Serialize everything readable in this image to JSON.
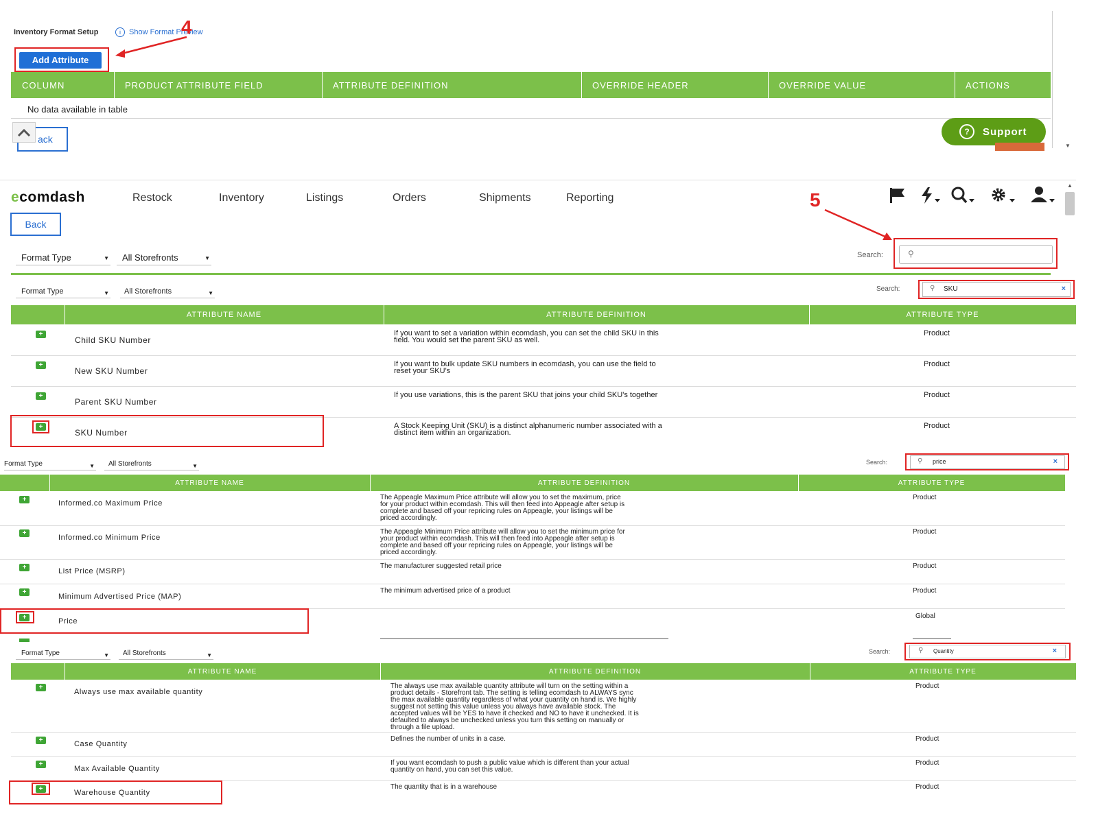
{
  "top": {
    "breadcrumb": "Inventory Format Setup",
    "info_icon": "info-circle-icon",
    "show_format_preview": "Show Format Preview",
    "add_attribute_label": "Add Attribute",
    "columns": [
      "COLUMN",
      "PRODUCT ATTRIBUTE FIELD",
      "ATTRIBUTE DEFINITION",
      "OVERRIDE HEADER",
      "OVERRIDE VALUE",
      "ACTIONS"
    ],
    "empty_text": "No data available in table",
    "back_label": "ack",
    "support_label": "Support",
    "annotation": "4"
  },
  "app": {
    "logo": "ecomdash",
    "nav": [
      "Restock",
      "Inventory",
      "Listings",
      "Orders",
      "Shipments",
      "Reporting"
    ],
    "back_label": "Back",
    "annotation": "5",
    "filter_format": "Format Type",
    "filter_store": "All Storefronts",
    "search_label": "Search:"
  },
  "panels": {
    "sku": {
      "search_value": "SKU",
      "headers": [
        "ATTRIBUTE NAME",
        "ATTRIBUTE DEFINITION",
        "ATTRIBUTE TYPE"
      ],
      "rows": [
        {
          "name": "Child SKU Number",
          "def1": "If you want to set a variation within ecomdash, you can set the child SKU in this",
          "def2": "field. You would set the parent SKU as well.",
          "type": "Product"
        },
        {
          "name": "New SKU Number",
          "def1": "If you want to bulk update SKU numbers in ecomdash, you can use the field to",
          "def2": "reset your SKU's",
          "type": "Product"
        },
        {
          "name": "Parent SKU Number",
          "def1": "If you use variations, this is the parent SKU that joins your child SKU's together",
          "def2": "",
          "type": "Product"
        },
        {
          "name": "SKU Number",
          "def1": "A Stock Keeping Unit (SKU) is a distinct alphanumeric number associated with a",
          "def2": "distinct item within an organization.",
          "type": "Product"
        }
      ]
    },
    "price": {
      "search_value": "price",
      "headers": [
        "ATTRIBUTE NAME",
        "ATTRIBUTE DEFINITION",
        "ATTRIBUTE TYPE"
      ],
      "rows": [
        {
          "name": "Informed.co Maximum Price",
          "def": [
            "The Appeagle Maximum Price attribute will allow you to set the maximum, price",
            "for your product within ecomdash. This will then feed into Appeagle after setup is",
            "complete and based off your repricing rules on Appeagle, your listings will be",
            "priced accordingly."
          ],
          "type": "Product"
        },
        {
          "name": "Informed.co Minimum Price",
          "def": [
            "The Appeagle Minimum Price attribute will allow you to set the minimum price for",
            "your product within ecomdash. This will then feed into Appeagle after setup is",
            "complete and based off your repricing rules on Appeagle, your listings will be",
            "priced accordingly."
          ],
          "type": "Product"
        },
        {
          "name": "List Price (MSRP)",
          "def": [
            "The manufacturer suggested retail price"
          ],
          "type": "Product"
        },
        {
          "name": "Minimum Advertised Price (MAP)",
          "def": [
            "The minimum advertised price of a product"
          ],
          "type": "Product"
        },
        {
          "name": "Price",
          "def": [],
          "type": "Global"
        }
      ]
    },
    "quantity": {
      "search_value": "Quantity",
      "headers": [
        "ATTRIBUTE NAME",
        "ATTRIBUTE DEFINITION",
        "ATTRIBUTE TYPE"
      ],
      "rows": [
        {
          "name": "Always use max available quantity",
          "def": [
            "The always use max available quantity attribute will turn on the setting within a",
            "product details - Storefront tab. The setting is telling ecomdash to ALWAYS sync",
            "the max available quantity regardless of what your quantity on hand is. We highly",
            "suggest not setting this value unless you always have available stock. The",
            "accepted values will be YES to have it checked and NO to have it unchecked. It is",
            "defaulted to always be unchecked unless you turn this setting on manually or",
            "through a file upload."
          ],
          "type": "Product"
        },
        {
          "name": "Case Quantity",
          "def": [
            "Defines the number of units in a case."
          ],
          "type": "Product"
        },
        {
          "name": "Max Available Quantity",
          "def": [
            "If you want ecomdash to push a public value which is different than your actual",
            "quantity on hand, you can set this value."
          ],
          "type": "Product"
        },
        {
          "name": "Warehouse Quantity",
          "def": [
            "The quantity that is in a warehouse"
          ],
          "type": "Product"
        }
      ]
    }
  },
  "icons": [
    "flag-icon",
    "lightning-icon",
    "search-icon",
    "gear-icon",
    "user-icon",
    "plus-icon",
    "chevron-up-icon",
    "question-circle-icon"
  ],
  "colors": {
    "header_green": "#7cc04a",
    "button_blue": "#1f6fd6",
    "annotation_red": "#e02424",
    "support_green": "#5d9d16"
  }
}
